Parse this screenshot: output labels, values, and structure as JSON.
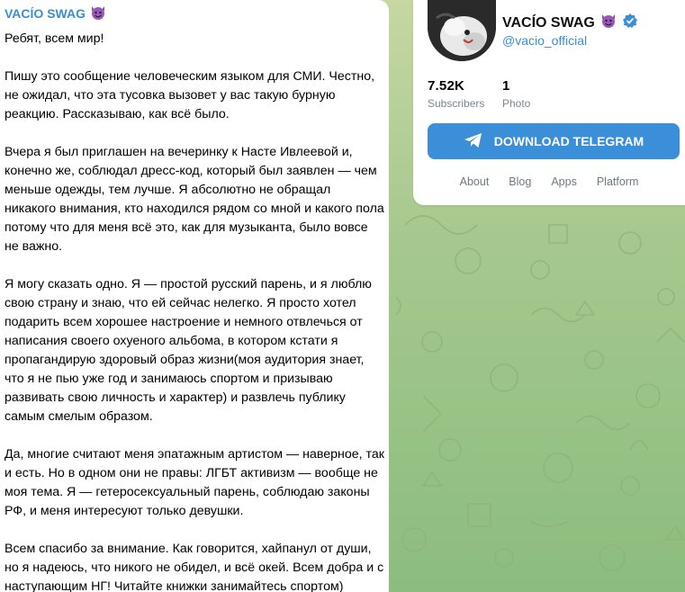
{
  "message": {
    "author": "VACÍO SWAG",
    "author_emoji": "devil-emoji",
    "paragraphs": [
      "Ребят, всем мир!",
      "Пишу это сообщение человеческим языком для СМИ. Честно, не ожидал, что эта тусовка вызовет у вас такую бурную реакцию. Рассказываю, как всё было.",
      "Вчера я был приглашен на вечеринку к Насте Ивлеевой и, конечно же, соблюдал дресс-код, который был заявлен — чем меньше одежды, тем лучше. Я абсолютно не обращал никакого внимания, кто находился рядом со мной и какого пола потому что для меня всё это, как для музыканта, было вовсе не важно.",
      "Я могу сказать одно. Я — простой русский парень, и я люблю свою страну и знаю, что ей сейчас нелегко. Я просто хотел подарить всем хорошее настроение и немного отвлечься от написания своего охуеного альбома, в котором кстати я пропагандирую здоровый образ жизни(моя аудитория знает, что я не пью уже год и занимаюсь спортом и призываю развивать свою личность и характер) и развлечь публику самым смелым образом.",
      "Да, многие считают меня эпатажным артистом — наверное, так и есть. Но в одном они не правы: ЛГБТ активизм — вообще не моя тема. Я — гетеросексуальный парень, соблюдаю законы РФ, и меня интересуют только девушки.",
      "Всем спасибо за внимание. Как говорится, хайпанул от души, но я надеюсь, что никого не обидел, и всё окей. Всем добра и с наступающим НГ! Читайте книжки занимайтесь спортом)"
    ]
  },
  "channel": {
    "title": "VACÍO SWAG",
    "verified_icon": "verified-badge-icon",
    "handle": "@vacio_official",
    "subscribers_count": "7.52K",
    "subscribers_label": "Subscribers",
    "photos_count": "1",
    "photos_label": "Photo",
    "download_label": "DOWNLOAD TELEGRAM",
    "links": [
      "About",
      "Blog",
      "Apps",
      "Platform"
    ]
  },
  "colors": {
    "accent": "#3a8fd8",
    "link": "#3a8fd0",
    "background": "#a6c88e"
  }
}
